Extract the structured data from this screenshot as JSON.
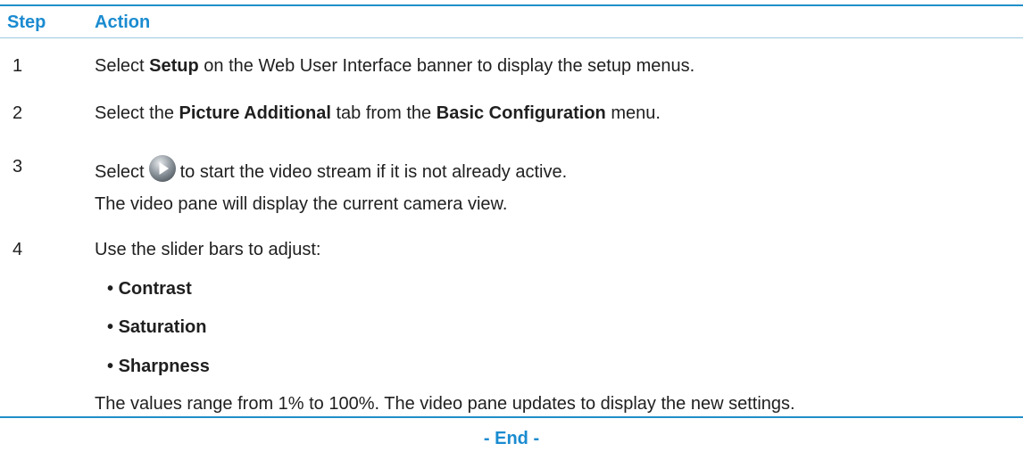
{
  "header": {
    "step": "Step",
    "action": "Action"
  },
  "steps": [
    {
      "num": "1",
      "parts": [
        "Select ",
        "Setup",
        " on the Web User Interface banner to display the setup menus."
      ]
    },
    {
      "num": "2",
      "parts": [
        "Select the ",
        "Picture Additional",
        " tab from the ",
        "Basic Configuration",
        " menu."
      ]
    },
    {
      "num": "3",
      "before": "Select",
      "icon": "play-icon",
      "after": "to start the video stream if it is not already active.",
      "note": "The video pane will display the current camera view."
    },
    {
      "num": "4",
      "text": "Use the slider bars to adjust:",
      "bullets": [
        "Contrast",
        "Saturation",
        "Sharpness"
      ],
      "note": "The values range from 1% to 100%. The video pane updates to display the new settings."
    }
  ],
  "footer": "- End -",
  "colors": {
    "accent": "#1a8bd0",
    "rule": "#1f8fc8"
  }
}
